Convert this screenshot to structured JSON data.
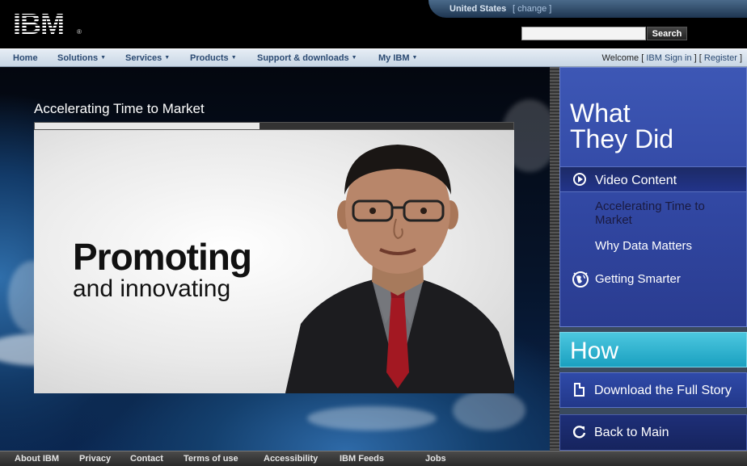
{
  "header": {
    "logo_text": "IBM",
    "country": "United States",
    "country_change": "[ change ]",
    "search_placeholder": "",
    "search_button": "Search"
  },
  "nav": {
    "items": [
      {
        "label": "Home",
        "has_menu": false
      },
      {
        "label": "Solutions",
        "has_menu": true
      },
      {
        "label": "Services",
        "has_menu": true
      },
      {
        "label": "Products",
        "has_menu": true
      },
      {
        "label": "Support & downloads",
        "has_menu": true
      },
      {
        "label": "My IBM",
        "has_menu": true
      }
    ],
    "welcome_prefix": "Welcome [",
    "sign_in": "IBM Sign in",
    "sep": "] [",
    "register": "Register",
    "welcome_suffix": "]"
  },
  "video": {
    "title": "Accelerating Time to Market",
    "headline": "Promoting",
    "subline": "and innovating",
    "progress_fraction": 0.47
  },
  "panel": {
    "what_title_1": "What",
    "what_title_2": "They Did",
    "video_content": "Video Content",
    "sub_items": [
      "Accelerating Time to Market",
      "Why Data Matters"
    ],
    "getting_smarter": "Getting Smarter",
    "how_title": "How",
    "download": "Download the Full Story",
    "back": "Back to Main"
  },
  "footer": {
    "links": [
      "About IBM",
      "Privacy",
      "Contact",
      "Terms of use",
      "Accessibility",
      "IBM Feeds",
      "Jobs"
    ]
  },
  "colors": {
    "nav_text": "#2b4a72",
    "panel_blue": "#3147a2",
    "how_cyan": "#1aa0c0"
  }
}
